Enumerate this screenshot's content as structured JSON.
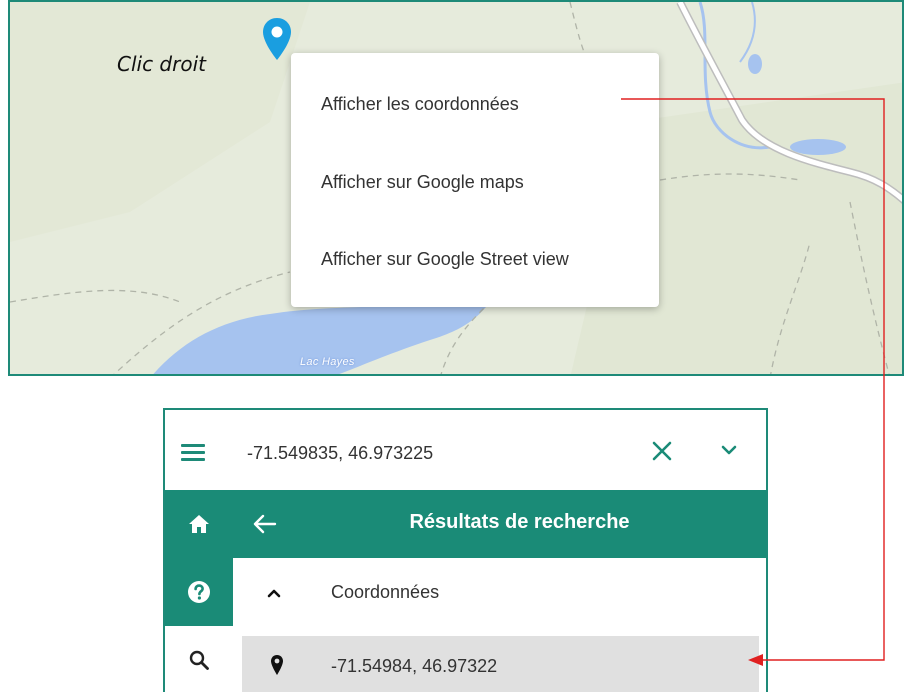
{
  "annotation": {
    "right_click_label": "Clic droit"
  },
  "map": {
    "lake_label": "Lac Hayes",
    "context_menu": {
      "items": [
        "Afficher les coordonnées",
        "Afficher sur Google maps",
        "Afficher sur Google Street view"
      ]
    }
  },
  "panel": {
    "search": {
      "value": "-71.549835, 46.973225"
    },
    "icons": {
      "menu": "hamburger-icon",
      "clear": "close-icon",
      "expand": "chevron-down-icon",
      "home": "home-icon",
      "help": "help-icon",
      "search": "search-icon",
      "back": "arrow-left-icon",
      "collapse": "chevron-up-icon",
      "result": "map-marker-icon"
    },
    "results": {
      "title": "Résultats de recherche",
      "group_label": "Coordonnées",
      "items": [
        "-71.54984, 46.97322"
      ]
    }
  },
  "colors": {
    "accent": "#1a8b77",
    "pin": "#1a9ee0",
    "annotation_line": "#e02020",
    "map_background": "#e6ebdc",
    "water": "#a6c3ef",
    "selected_row": "#e0e0e0"
  }
}
